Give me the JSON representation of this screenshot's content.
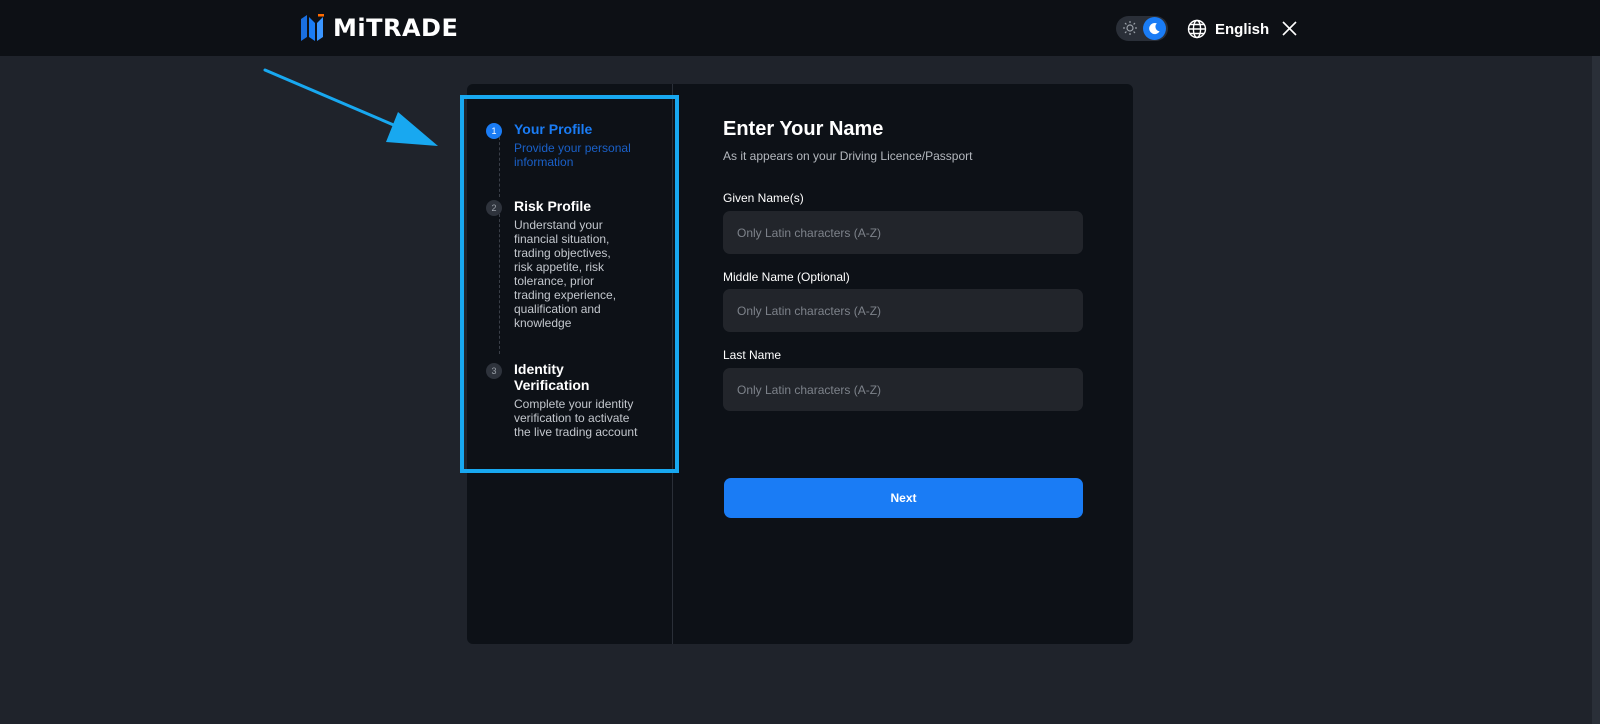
{
  "header": {
    "logo_text": "MiTRADE",
    "language": "English",
    "theme": "dark",
    "icons": [
      "logo-mark-icon",
      "sun-icon",
      "moon-icon",
      "globe-icon",
      "close-icon"
    ]
  },
  "steps": [
    {
      "number": "1",
      "title": "Your Profile",
      "description": "Provide your personal information",
      "active": true
    },
    {
      "number": "2",
      "title": "Risk Profile",
      "description": "Understand your financial situation, trading objectives, risk appetite, risk tolerance, prior trading experience, qualification and knowledge",
      "active": false
    },
    {
      "number": "3",
      "title": "Identity Verification",
      "description": "Complete your identity verification to activate the live trading account",
      "active": false
    }
  ],
  "form": {
    "title": "Enter Your Name",
    "subtitle": "As it appears on your Driving Licence/Passport",
    "fields": [
      {
        "label": "Given Name(s)",
        "placeholder": "Only Latin characters (A-Z)",
        "value": ""
      },
      {
        "label": "Middle Name (Optional)",
        "placeholder": "Only Latin characters (A-Z)",
        "value": ""
      },
      {
        "label": "Last Name",
        "placeholder": "Only Latin characters (A-Z)",
        "value": ""
      }
    ],
    "next_label": "Next"
  },
  "colors": {
    "accent": "#1a7cf5",
    "highlight_border": "#18a8f0",
    "panel_bg": "#0d1117",
    "page_bg": "#1f232b"
  }
}
